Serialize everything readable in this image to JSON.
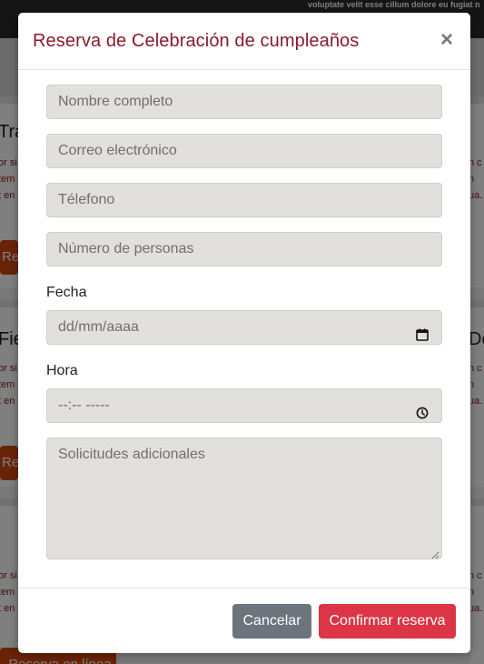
{
  "background": {
    "topbar_text": "voluptate velit esse cillum dolore eu fugiat nulla pariatur. Excepteur sint",
    "cards": [
      {
        "title": "Trad",
        "lines": "or si\ntem\nt en",
        "button": "Re"
      },
      {
        "title": "Fies",
        "lines": "or si\ntem\nt en",
        "button": "Re"
      },
      {
        "title": "",
        "lines": "or si\ntem\nt en",
        "button": "Reserva en línea"
      }
    ],
    "right_cards": [
      {
        "title": "",
        "lines": "n c\nn\nua."
      },
      {
        "title": "Dec",
        "lines": "n c\nn\nua."
      },
      {
        "title": "",
        "lines": "n c\nn\nua."
      }
    ]
  },
  "modal": {
    "title": "Reserva de Celebración de cumpleaños",
    "close_symbol": "×",
    "fields": {
      "name_placeholder": "Nombre completo",
      "email_placeholder": "Correo electrónico",
      "phone_placeholder": "Télefono",
      "people_placeholder": "Número de personas",
      "date_label": "Fecha",
      "date_placeholder": "dd/mm/aaaa",
      "time_label": "Hora",
      "time_placeholder": "--:-- -----",
      "requests_placeholder": "Solicitudes adicionales"
    },
    "footer": {
      "cancel_label": "Cancelar",
      "confirm_label": "Confirmar reserva"
    }
  },
  "colors": {
    "title": "#8b1a2b",
    "cancel": "#6c757d",
    "confirm": "#dc3545",
    "field_bg": "#e1e0dc"
  },
  "icons": {
    "date": "calendar-icon",
    "time": "clock-icon",
    "close": "close-icon"
  }
}
